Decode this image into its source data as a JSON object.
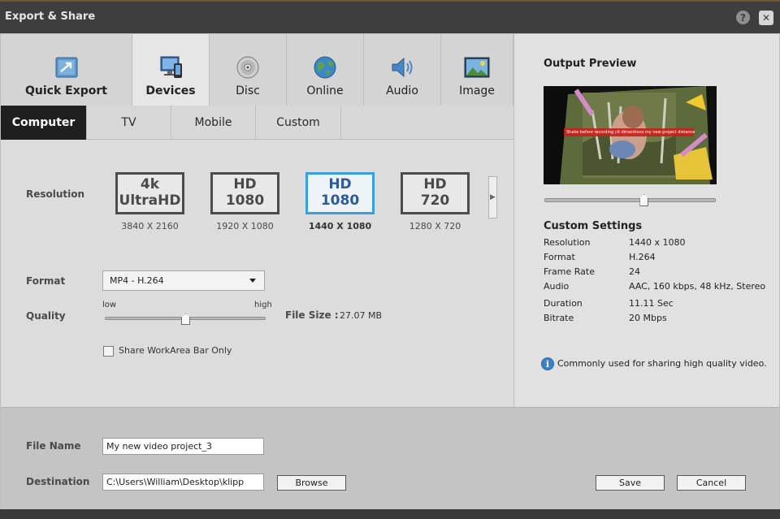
{
  "window": {
    "title": "Export & Share",
    "help_glyph": "?",
    "close_glyph": "✕"
  },
  "main_tabs": [
    {
      "label": "Quick Export",
      "icon": "quick-export-icon"
    },
    {
      "label": "Devices",
      "icon": "devices-icon",
      "active": true
    },
    {
      "label": "Disc",
      "icon": "disc-icon"
    },
    {
      "label": "Online",
      "icon": "globe-icon"
    },
    {
      "label": "Audio",
      "icon": "speaker-icon"
    },
    {
      "label": "Image",
      "icon": "image-icon"
    }
  ],
  "sub_tabs": [
    {
      "label": "Computer",
      "active": true
    },
    {
      "label": "TV"
    },
    {
      "label": "Mobile"
    },
    {
      "label": "Custom"
    }
  ],
  "resolution": {
    "label": "Resolution",
    "options": [
      {
        "line1": "4k",
        "line2": "UltraHD",
        "dims": "3840 X 2160"
      },
      {
        "line1": "HD",
        "line2": "1080",
        "dims": "1920 X 1080"
      },
      {
        "line1": "HD",
        "line2": "1080",
        "dims": "1440 X 1080",
        "selected": true
      },
      {
        "line1": "HD",
        "line2": "720",
        "dims": "1280 X 720"
      }
    ],
    "next_glyph": "▶"
  },
  "format": {
    "label": "Format",
    "value": "MP4 - H.264"
  },
  "quality": {
    "label": "Quality",
    "low": "low",
    "high": "high",
    "level": 0.5
  },
  "file_size": {
    "label": "File Size :",
    "value": "27.07 MB"
  },
  "share_workarea": {
    "label": "Share WorkArea Bar Only",
    "checked": false
  },
  "output_preview": {
    "title": "Output Preview",
    "overlay_text": "Shake before recording cit dimentions my new project distance. Create a new project.",
    "scrub_position": 0.58
  },
  "custom_settings": {
    "title": "Custom Settings",
    "rows": [
      {
        "k": "Resolution",
        "v": "1440 x 1080"
      },
      {
        "k": "Format",
        "v": "H.264"
      },
      {
        "k": "Frame Rate",
        "v": "24"
      },
      {
        "k": "Audio",
        "v": "AAC, 160 kbps, 48 kHz, Stereo"
      },
      {
        "k": "Duration",
        "v": "11.11 Sec"
      },
      {
        "k": "Bitrate",
        "v": "20 Mbps"
      }
    ]
  },
  "info": {
    "glyph": "i",
    "text": "Commonly used for sharing high quality video."
  },
  "footer": {
    "file_name_label": "File Name",
    "file_name_value": "My new video project_3",
    "destination_label": "Destination",
    "destination_value": "C:\\Users\\William\\Desktop\\klipp",
    "browse": "Browse",
    "save": "Save",
    "cancel": "Cancel"
  },
  "colors": {
    "accent_selected": "#39a0dd",
    "selected_text": "#2f5a93",
    "active_subtab_bg": "#1f1f1f",
    "info_blue": "#3d82c6"
  }
}
